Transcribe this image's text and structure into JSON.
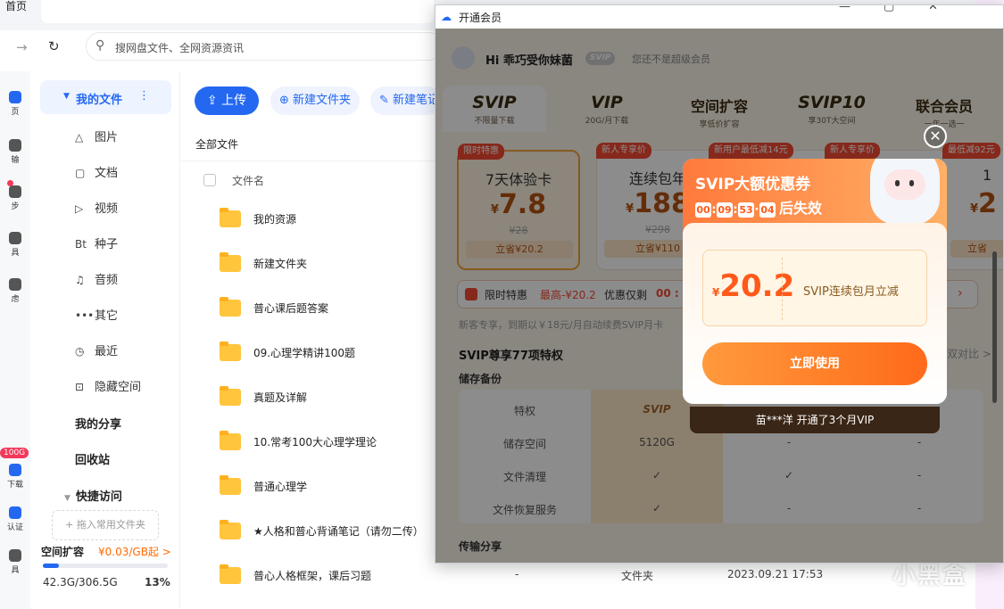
{
  "browser": {
    "home_tab": "首页",
    "search_placeholder": "搜网盘文件、全网资源资讯"
  },
  "rail": {
    "items": [
      "页",
      "输",
      "步",
      "具",
      "虑"
    ],
    "badge": "100G",
    "bottom": [
      "下载",
      "认证",
      "具"
    ]
  },
  "sidebar": {
    "my_files": "我的文件",
    "items": [
      {
        "icon": "△",
        "label": "图片"
      },
      {
        "icon": "▢",
        "label": "文档"
      },
      {
        "icon": "▷",
        "label": "视频"
      },
      {
        "icon": "Bt",
        "label": "种子"
      },
      {
        "icon": "♫",
        "label": "音频"
      },
      {
        "icon": "•••",
        "label": "其它"
      },
      {
        "icon": "◷",
        "label": "最近"
      },
      {
        "icon": "⊡",
        "label": "隐藏空间"
      }
    ],
    "my_share": "我的分享",
    "recycle": "回收站",
    "quick_access": "快捷访问",
    "drop_hint": "+ 拖入常用文件夹",
    "quota": {
      "title": "空间扩容",
      "price": "¥0.03/GB起 >",
      "usage": "42.3G/306.5G",
      "percent_label": "13%",
      "percent": 0.13
    }
  },
  "main": {
    "upload": "上传",
    "new_folder": "新建文件夹",
    "new_note": "新建笔记",
    "breadcrumb": "全部文件",
    "col_filename": "文件名",
    "files": [
      {
        "name": "我的资源"
      },
      {
        "name": "新建文件夹"
      },
      {
        "name": "普心课后题答案"
      },
      {
        "name": "09.心理学精讲100题"
      },
      {
        "name": "真题及详解"
      },
      {
        "name": "10.常考100大心理学理论"
      },
      {
        "name": "普通心理学"
      },
      {
        "name": "★人格和普心背诵笔记（请勿二传）"
      },
      {
        "name": "普心人格框架，课后习题",
        "c1": "-",
        "c2": "文件夹",
        "c3": "2023.09.21 17:53"
      }
    ]
  },
  "vip_window": {
    "title": "开通会员",
    "greeting": "Hi 乖巧受你妹菌",
    "svip_badge": "SVIP",
    "status": "您还不是超级会员",
    "tabs": [
      {
        "head": "SVIP",
        "sub": "不限量下载"
      },
      {
        "head": "VIP",
        "sub": "20G/月下载"
      },
      {
        "head": "空间扩容",
        "sub": "享低价扩容"
      },
      {
        "head": "SVIP10",
        "sub": "享30T大空间"
      },
      {
        "head": "联合会员",
        "sub": "一年一选一"
      }
    ],
    "cards": [
      {
        "tag": "限时特惠",
        "name": "7天体验卡",
        "currency": "¥",
        "price": "7.8",
        "old": "¥28",
        "save": "立省¥20.2"
      },
      {
        "tag": "新人专享价",
        "name": "连续包年",
        "currency": "¥",
        "price": "188",
        "old": "¥298",
        "save": "立省¥110"
      },
      {
        "tag": "新用户最低减14元",
        "name": "",
        "currency": "",
        "price": "",
        "old": "",
        "save": ""
      },
      {
        "tag": "新人专享价",
        "name": "",
        "currency": "",
        "price": "",
        "old": "",
        "save": ""
      },
      {
        "tag": "最低减92元",
        "name": "1",
        "currency": "¥",
        "price": "2",
        "old": "",
        "save": "立省"
      }
    ],
    "promo": {
      "title": "限时特惠",
      "reduce": "最高-¥20.2",
      "deadline": "优惠仅剩",
      "countdown": "00 :"
    },
    "notice": "新客专享，到期以￥18元/月自动续费SVIP月卡",
    "privilege_title": "SVIP尊享77项特权",
    "compare": "双对比 >",
    "storage_title": "储存备份",
    "table_header": {
      "label": "特权",
      "svip": "SVIP"
    },
    "table_rows": [
      {
        "label": "储存空间",
        "svip": "5120G",
        "vip": "-",
        "normal": "-"
      },
      {
        "label": "文件清理",
        "svip": "✓",
        "vip": "✓",
        "normal": "-"
      },
      {
        "label": "文件恢复服务",
        "svip": "✓",
        "vip": "-",
        "normal": "-"
      }
    ],
    "transfer_title": "传输分享",
    "coupon": {
      "title": "SVIP大额优惠券",
      "timer": [
        "00",
        "09",
        "53",
        "04"
      ],
      "timer_label": "后失效",
      "currency": "¥",
      "amount": "20.2",
      "desc": "SVIP连续包月立减",
      "use_button": "立即使用"
    },
    "purchase_banner": "苗***洋 开通了3个月VIP"
  },
  "watermark": "小黑盒"
}
